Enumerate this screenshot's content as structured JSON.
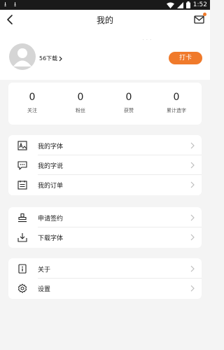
{
  "status_bar": {
    "time": "1:52",
    "icons": [
      "download-icon",
      "download-icon",
      "wifi-icon",
      "signal-icon",
      "battery-icon"
    ]
  },
  "nav": {
    "title": "我的",
    "back_icon": "back-arrow-icon",
    "mail_icon": "mail-icon"
  },
  "profile": {
    "downloads_label": "56下载",
    "checkin_label": "打卡",
    "faint_marks": "· · ·"
  },
  "stats": [
    {
      "value": "0",
      "label": "关注"
    },
    {
      "value": "0",
      "label": "粉丝"
    },
    {
      "value": "0",
      "label": "获赞"
    },
    {
      "value": "0",
      "label": "累计造字"
    }
  ],
  "menu_groups": [
    [
      {
        "label": "我的字体",
        "icon": "font-image-icon"
      },
      {
        "label": "我的字说",
        "icon": "message-icon"
      },
      {
        "label": "我的订单",
        "icon": "order-list-icon"
      }
    ],
    [
      {
        "label": "申请签约",
        "icon": "stamp-icon"
      },
      {
        "label": "下载字体",
        "icon": "download-box-icon"
      }
    ],
    [
      {
        "label": "关于",
        "icon": "info-icon"
      },
      {
        "label": "设置",
        "icon": "gear-icon"
      }
    ]
  ],
  "colors": {
    "accent": "#f07a2b",
    "background": "#f4f4f4",
    "status_bar": "#1a1a1a"
  }
}
